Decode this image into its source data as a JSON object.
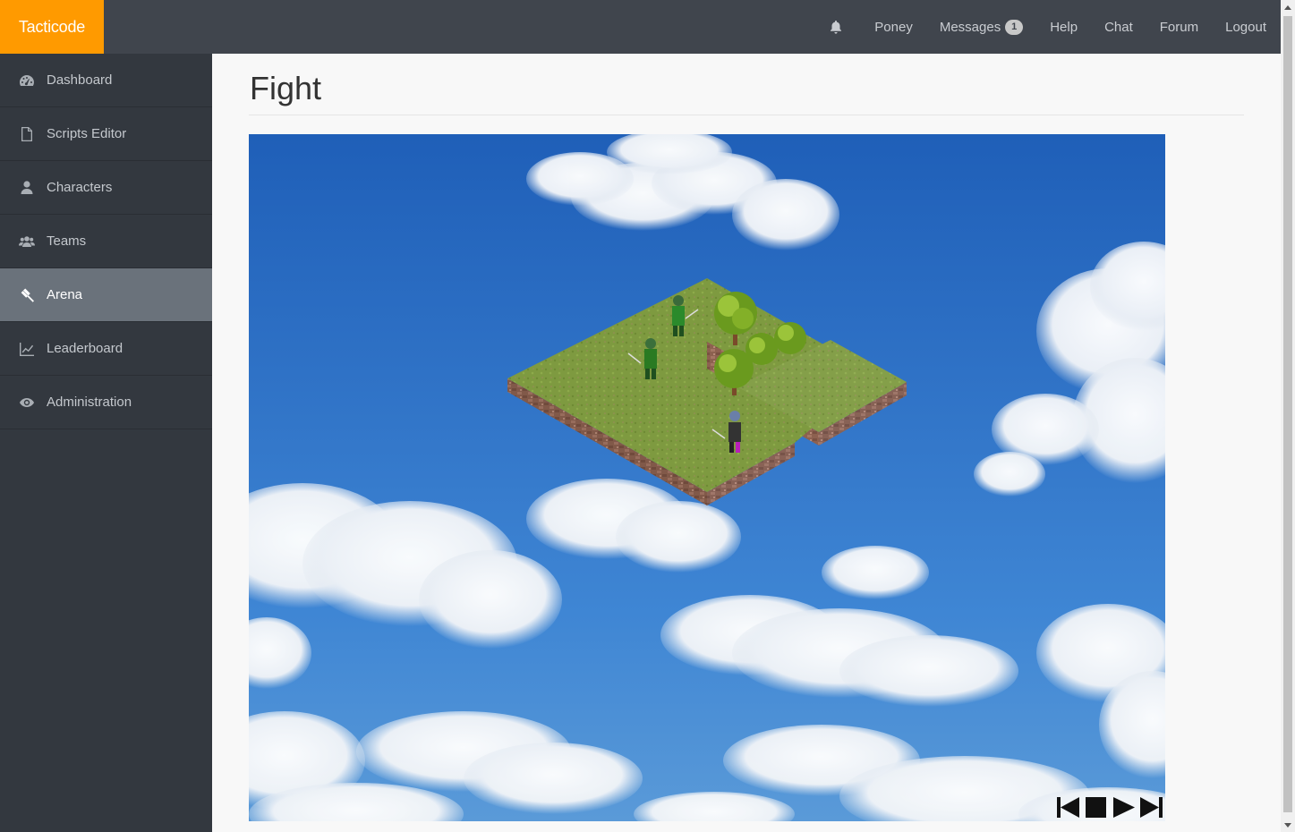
{
  "brand": "Tacticode",
  "nav": {
    "bell_icon": "bell-icon",
    "user": "Poney",
    "messages": "Messages",
    "messages_count": "1",
    "help": "Help",
    "chat": "Chat",
    "forum": "Forum",
    "logout": "Logout"
  },
  "sidebar": {
    "items": [
      {
        "label": "Dashboard",
        "icon": "dashboard-icon"
      },
      {
        "label": "Scripts Editor",
        "icon": "file-icon"
      },
      {
        "label": "Characters",
        "icon": "user-icon"
      },
      {
        "label": "Teams",
        "icon": "users-icon"
      },
      {
        "label": "Arena",
        "icon": "gavel-icon",
        "active": true
      },
      {
        "label": "Leaderboard",
        "icon": "chart-icon"
      },
      {
        "label": "Administration",
        "icon": "eye-icon"
      }
    ]
  },
  "page": {
    "title": "Fight"
  },
  "controls": {
    "first": "skip-to-start-icon",
    "stop": "stop-icon",
    "play": "play-icon",
    "last": "skip-to-end-icon"
  },
  "colors": {
    "brand": "#ff9a00",
    "navbar": "#40454d",
    "sidebar": "#33383f",
    "sidebar_active": "#6a727b",
    "sky": "#2f72c6",
    "grass": "#7d9a3e",
    "dirt": "#8a5f4a"
  }
}
